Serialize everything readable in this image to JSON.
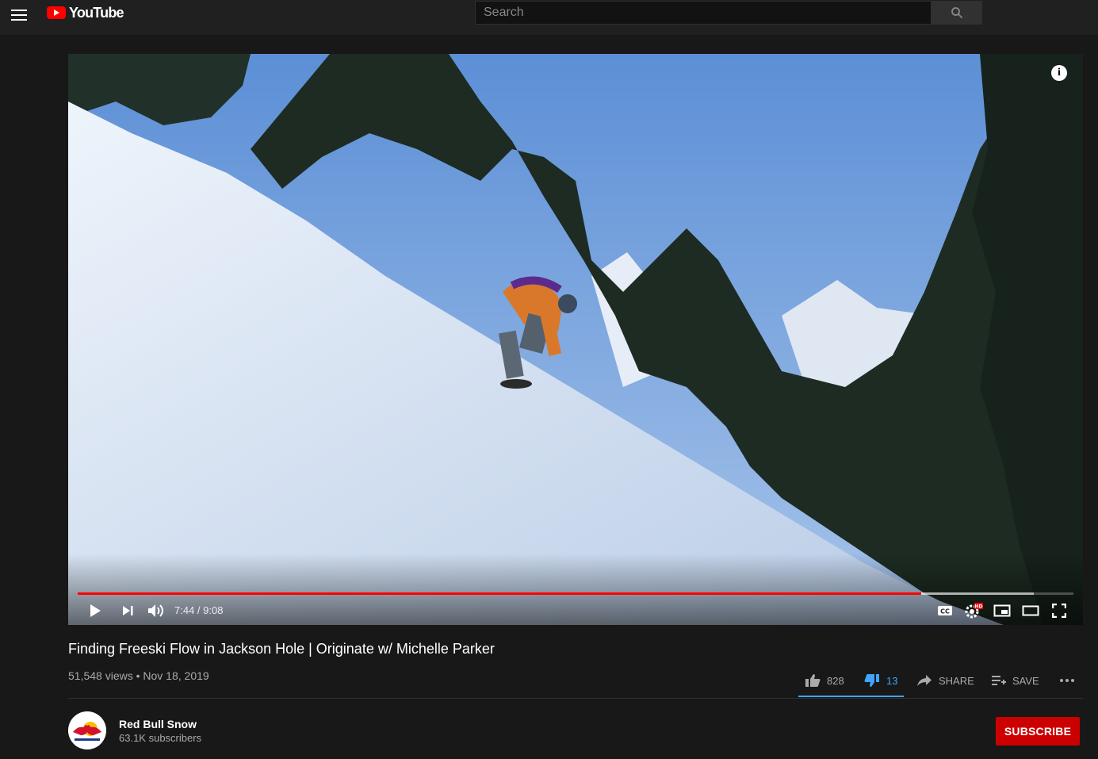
{
  "header": {
    "logo_text": "YouTube",
    "search_placeholder": "Search"
  },
  "player": {
    "time_display": "7:44 / 9:08",
    "progress_fraction": 0.847,
    "buffer_fraction": 0.96
  },
  "video": {
    "title": "Finding Freeski Flow in Jackson Hole | Originate w/ Michelle Parker",
    "views_date": "51,548 views • Nov 18, 2019"
  },
  "actions": {
    "likes": "828",
    "dislikes": "13",
    "share_label": "SHARE",
    "save_label": "SAVE"
  },
  "channel": {
    "name": "Red Bull Snow",
    "subscribers": "63.1K subscribers",
    "subscribe_label": "SUBSCRIBE"
  },
  "colors": {
    "accent": "#ff0000",
    "subscribe": "#cc0000",
    "active_blue": "#3ea6ff"
  }
}
